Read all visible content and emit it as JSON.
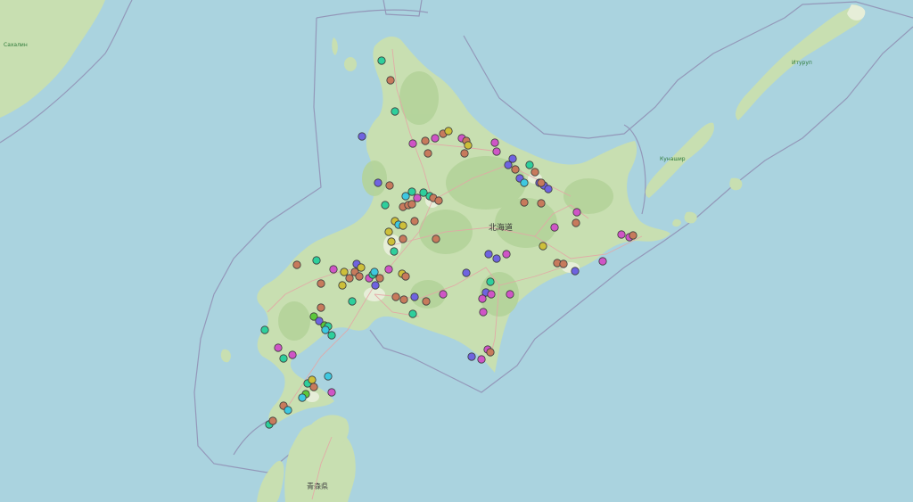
{
  "map": {
    "labels": {
      "hokkaido": "北海道",
      "aomori": "青森県",
      "kunashir": "Кунашир",
      "iturup": "Итуруп",
      "sakhalin": "Сахалин"
    },
    "colors": {
      "sea": "#aad3df",
      "land": "#c8dfb1",
      "land_light": "#e6eed8",
      "forest": "#b4d39a",
      "border": "#8e8ab0",
      "road": "#e4a6a6",
      "marker_stroke": "#3a3a3a"
    },
    "marker_palette": {
      "purple": "#6f63e0",
      "magenta": "#cf55c6",
      "teal": "#2ecf9c",
      "brown": "#c77a5c",
      "yellow": "#cdbf3a",
      "cyan": "#3ec8e0",
      "green": "#5cc83a"
    }
  }
}
